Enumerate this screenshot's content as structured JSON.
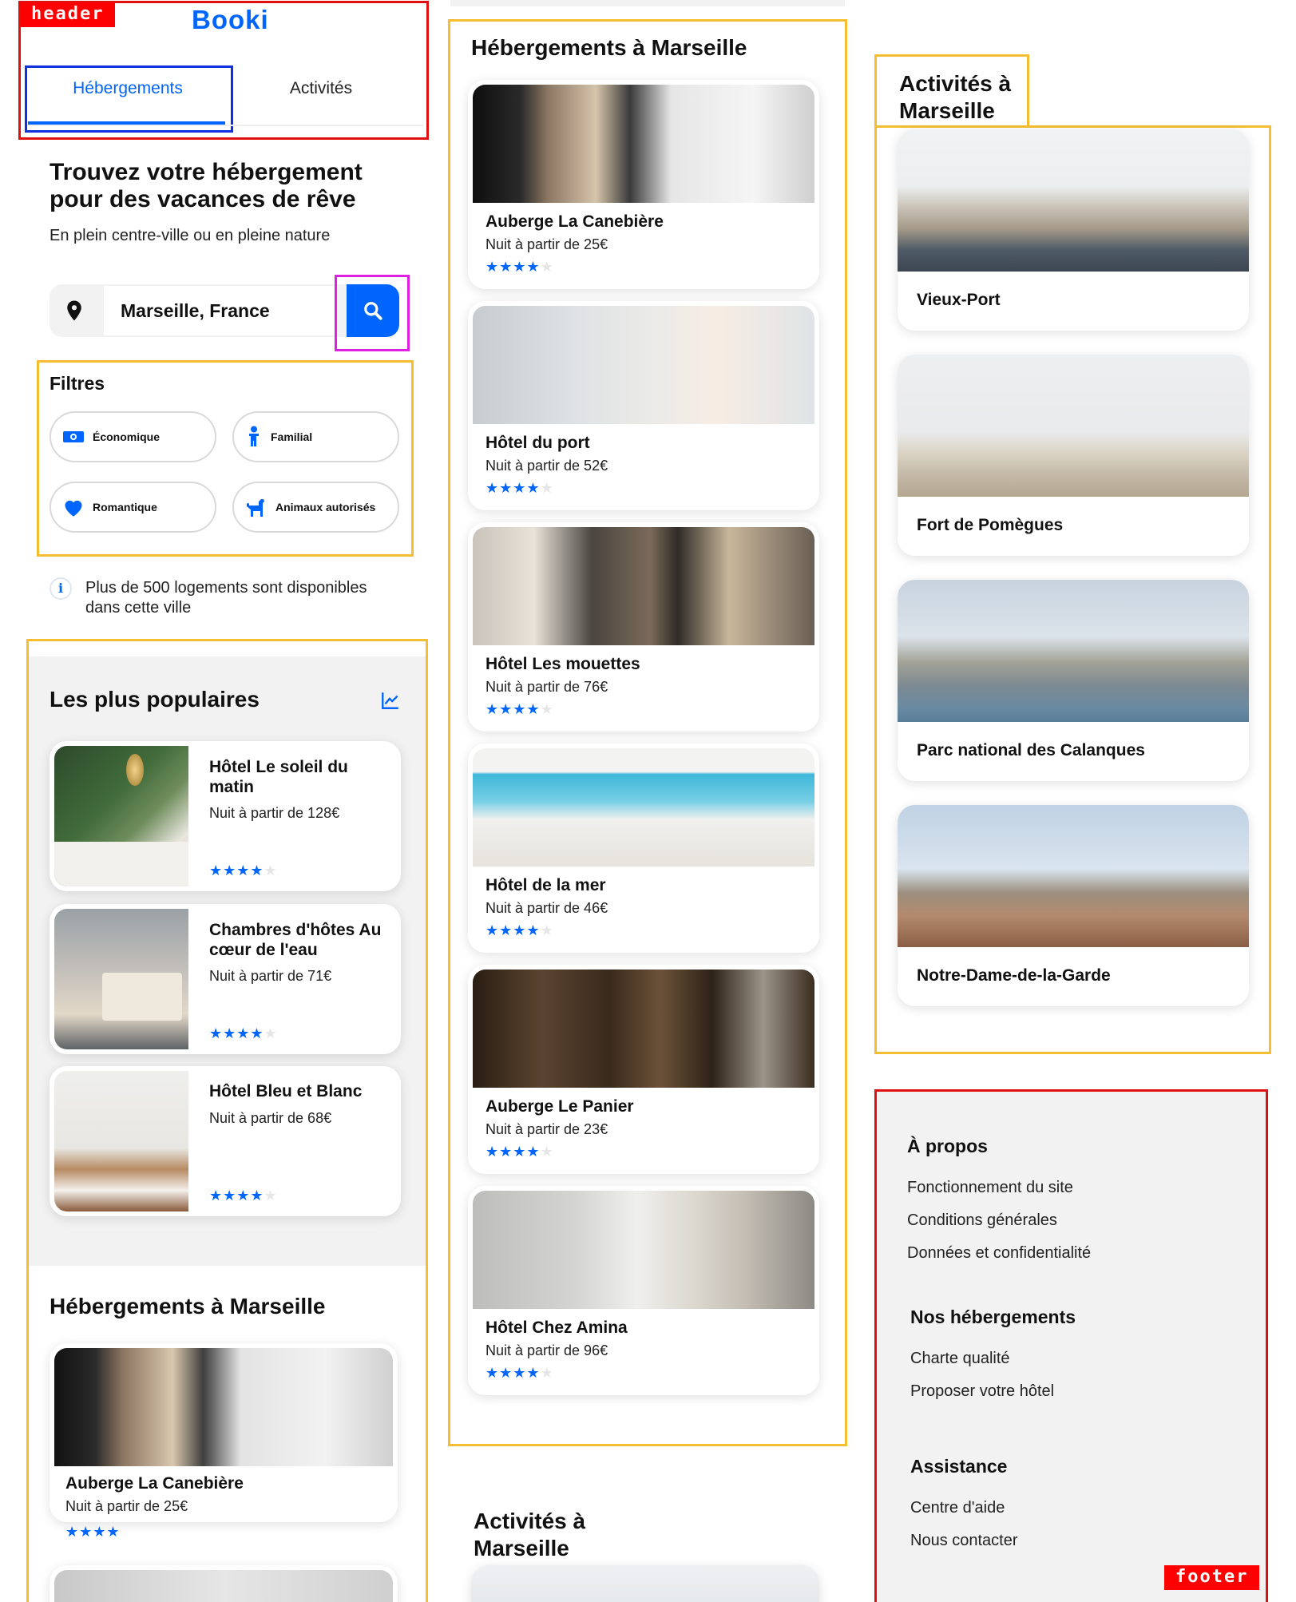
{
  "annotations": {
    "header_tag": "header",
    "footer_tag": "footer"
  },
  "header": {
    "logo": "Booki",
    "tabs": [
      {
        "label": "Hébergements",
        "active": true
      },
      {
        "label": "Activités",
        "active": false
      }
    ]
  },
  "hero": {
    "title_line1": "Trouvez votre hébergement",
    "title_line2": "pour des vacances de rêve",
    "subtitle": "En plein centre-ville ou en pleine nature"
  },
  "search": {
    "value": "Marseille, France",
    "location_icon": "location-pin-icon",
    "button_icon": "search-icon"
  },
  "filters": {
    "title": "Filtres",
    "items": [
      {
        "label": "Économique",
        "icon": "money-icon"
      },
      {
        "label": "Familial",
        "icon": "person-icon"
      },
      {
        "label": "Romantique",
        "icon": "heart-icon"
      },
      {
        "label": "Animaux autorisés",
        "icon": "dog-icon"
      }
    ]
  },
  "info": {
    "line1": "Plus de 500 logements sont disponibles",
    "line2": "dans cette ville"
  },
  "popular": {
    "title": "Les plus populaires",
    "items": [
      {
        "name_line1": "Hôtel Le soleil du",
        "name_line2": "matin",
        "price": "Nuit à partir de 128€",
        "rating": 4
      },
      {
        "name_line1": "Chambres d'hôtes Au",
        "name_line2": "cœur de l'eau",
        "price": "Nuit à partir de 71€",
        "rating": 4
      },
      {
        "name_line1": "Hôtel Bleu et Blanc",
        "name_line2": "",
        "price": "Nuit à partir de 68€",
        "rating": 4
      }
    ]
  },
  "lodging_left": {
    "title": "Hébergements à Marseille",
    "first": {
      "name": "Auberge La Canebière",
      "price": "Nuit à partir de 25€",
      "rating": 4
    }
  },
  "lodging": {
    "title": "Hébergements à Marseille",
    "items": [
      {
        "name": "Auberge La Canebière",
        "price": "Nuit à partir de 25€",
        "rating": 4
      },
      {
        "name": "Hôtel du port",
        "price": "Nuit à partir de 52€",
        "rating": 4
      },
      {
        "name": "Hôtel Les mouettes",
        "price": "Nuit à partir de 76€",
        "rating": 4
      },
      {
        "name": "Hôtel de la mer",
        "price": "Nuit à partir de 46€",
        "rating": 4
      },
      {
        "name": "Auberge Le Panier",
        "price": "Nuit à partir de 23€",
        "rating": 4
      },
      {
        "name": "Hôtel Chez Amina",
        "price": "Nuit à partir de 96€",
        "rating": 4
      }
    ]
  },
  "activities_mid": {
    "title_line1": "Activités à",
    "title_line2": "Marseille"
  },
  "activities": {
    "title_line1": "Activités à",
    "title_line2": "Marseille",
    "items": [
      {
        "name": "Vieux-Port"
      },
      {
        "name": "Fort de Pomègues"
      },
      {
        "name": "Parc national des Calanques"
      },
      {
        "name": "Notre-Dame-de-la-Garde"
      }
    ]
  },
  "footer": {
    "sections": [
      {
        "title": "À propos",
        "links": [
          "Fonctionnement du site",
          "Conditions générales",
          "Données et confidentialité"
        ]
      },
      {
        "title": "Nos hébergements",
        "links": [
          "Charte qualité",
          "Proposer votre hôtel"
        ]
      },
      {
        "title": "Assistance",
        "links": [
          "Centre d'aide",
          "Nous contacter"
        ]
      }
    ]
  }
}
